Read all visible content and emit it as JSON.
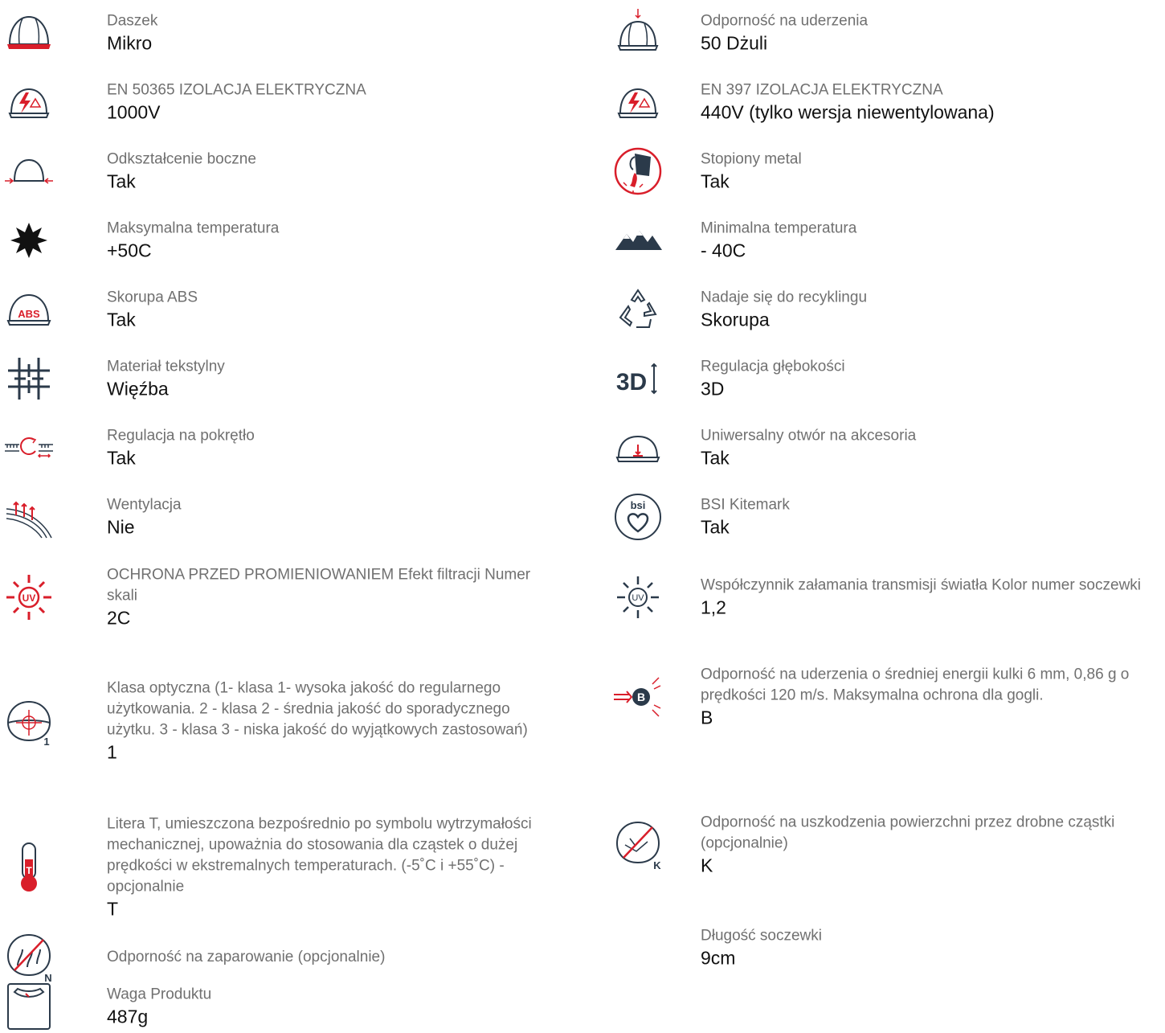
{
  "colors": {
    "icon_dark": "#2b3a4a",
    "icon_red": "#d91e2a",
    "label_gray": "#707070",
    "value_black": "#111111"
  },
  "left": [
    {
      "icon": "helmet-peak-icon",
      "label": "Daszek",
      "value": "Mikro"
    },
    {
      "icon": "electric-insulation-icon",
      "label": "EN 50365 IZOLACJA ELEKTRYCZNA",
      "value": "1000V"
    },
    {
      "icon": "lateral-deformation-icon",
      "label": "Odkształcenie boczne",
      "value": "Tak"
    },
    {
      "icon": "max-temperature-sun-icon",
      "label": "Maksymalna temperatura",
      "value": "+50C"
    },
    {
      "icon": "abs-shell-icon",
      "label": "Skorupa ABS",
      "value": "Tak",
      "icon_text": "ABS"
    },
    {
      "icon": "textile-material-icon",
      "label": "Materiał tekstylny",
      "value": "Więźba"
    },
    {
      "icon": "ratchet-adjustment-icon",
      "label": "Regulacja na pokrętło",
      "value": "Tak"
    },
    {
      "icon": "ventilation-icon",
      "label": "Wentylacja",
      "value": "Nie"
    },
    {
      "icon": "uv-protection-icon",
      "label": "OCHRONA PRZED PROMIENIOWANIEM Efekt filtracji Numer skali",
      "value": "2C",
      "icon_text": "UV"
    },
    {
      "icon": "optical-class-icon",
      "label": "Klasa optyczna (1- klasa 1- wysoka jakość do regularnego użytkowania. 2 - klasa 2 - średnia jakość do sporadycznego użytku. 3 - klasa 3 - niska jakość do wyjątkowych zastosowań)",
      "value": "1",
      "icon_text": "1"
    },
    {
      "icon": "thermometer-icon",
      "label": "Litera T, umieszczona bezpośrednio po symbolu wytrzymałości mechanicznej, upoważnia do stosowania dla cząstek o dużej prędkości w ekstremalnych temperaturach. (-5˚C i +55˚C) - opcjonalnie",
      "value": "T",
      "icon_text": "T"
    },
    {
      "icon": "anti-fog-icon",
      "label": "Odporność na zaparowanie (opcjonalnie)",
      "value": "",
      "icon_text": "N"
    },
    {
      "icon": "weight-scale-icon",
      "label": "Waga Produktu",
      "value": "487g"
    }
  ],
  "right": [
    {
      "icon": "impact-resistance-icon",
      "label": "Odporność na uderzenia",
      "value": "50 Dżuli"
    },
    {
      "icon": "electric-insulation-icon",
      "label": "EN 397 IZOLACJA ELEKTRYCZNA",
      "value": "440V (tylko wersja niewentylowana)"
    },
    {
      "icon": "molten-metal-icon",
      "label": "Stopiony metal",
      "value": "Tak"
    },
    {
      "icon": "min-temperature-mountains-icon",
      "label": "Minimalna temperatura",
      "value": "- 40C"
    },
    {
      "icon": "recycle-icon",
      "label": "Nadaje się do recyklingu",
      "value": "Skorupa"
    },
    {
      "icon": "depth-adjustment-3d-icon",
      "label": "Regulacja głębokości",
      "value": "3D",
      "icon_text": "3D"
    },
    {
      "icon": "accessory-slot-icon",
      "label": "Uniwersalny otwór na akcesoria",
      "value": "Tak"
    },
    {
      "icon": "bsi-kitemark-icon",
      "label": "BSI Kitemark",
      "value": "Tak",
      "icon_text": "bsi"
    },
    {
      "icon": "light-transmission-icon",
      "label": "Współczynnik załamania transmisji światła Kolor numer soczewki",
      "value": "1,2",
      "icon_text": "UV"
    },
    {
      "icon": "impact-b-icon",
      "label": "Odporność na uderzenia o średniej energii kulki 6 mm, 0,86 g o prędkości 120 m/s. Maksymalna ochrona dla gogli.",
      "value": "B",
      "icon_text": "B"
    },
    {
      "icon": "surface-damage-icon",
      "label": "Odporność na uszkodzenia powierzchni przez drobne cząstki (opcjonalnie)",
      "value": "K",
      "icon_text": "K"
    },
    {
      "icon": "lens-length-icon",
      "label": "Długość soczewki",
      "value": "9cm"
    }
  ]
}
